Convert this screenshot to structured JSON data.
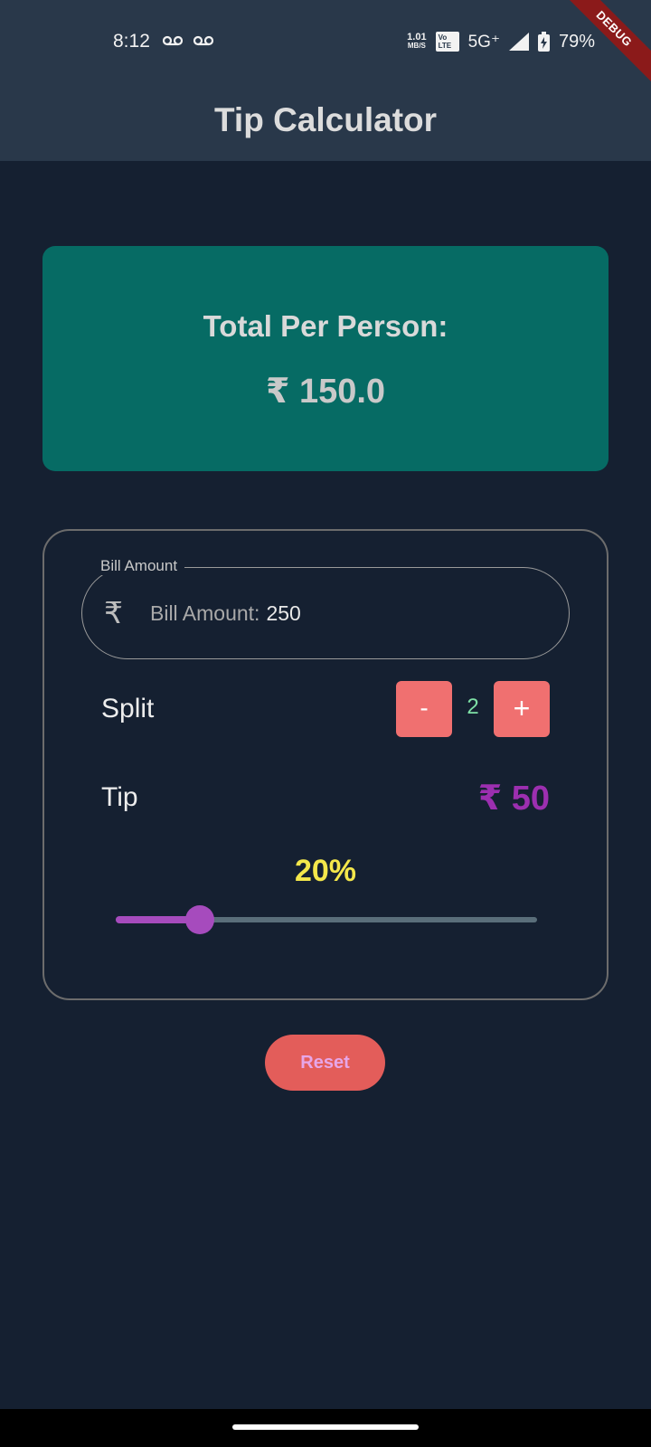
{
  "status_bar": {
    "time": "8:12",
    "net_speed_value": "1.01",
    "net_speed_unit": "MB/S",
    "volte_top": "Vo",
    "volte_bottom": "LTE",
    "network_type": "5G⁺",
    "battery": "79%",
    "icons": [
      "voicemail-icon",
      "voicemail-icon",
      "signal-icon",
      "battery-charging-icon"
    ]
  },
  "debug_banner": "DEBUG",
  "app_bar": {
    "title": "Tip Calculator"
  },
  "total_card": {
    "label": "Total Per Person:",
    "value": "₹ 150.0",
    "background": "#066b64"
  },
  "bill_field": {
    "legend": "Bill Amount",
    "icon": "₹",
    "label": "Bill Amount:",
    "value": "250"
  },
  "split": {
    "label": "Split",
    "minus_label": "-",
    "plus_label": "+",
    "count": "2"
  },
  "tip": {
    "label": "Tip",
    "amount": "₹ 50",
    "percent": "20%",
    "slider_fraction": 0.2
  },
  "reset_label": "Reset",
  "colors": {
    "background": "#152031",
    "app_bar": "#29384a",
    "stepper": "#f07070",
    "tip_amount": "#9c2fb0",
    "tip_percent": "#f4e74b",
    "slider": "#a64bbd",
    "reset": "#e35d5a"
  }
}
